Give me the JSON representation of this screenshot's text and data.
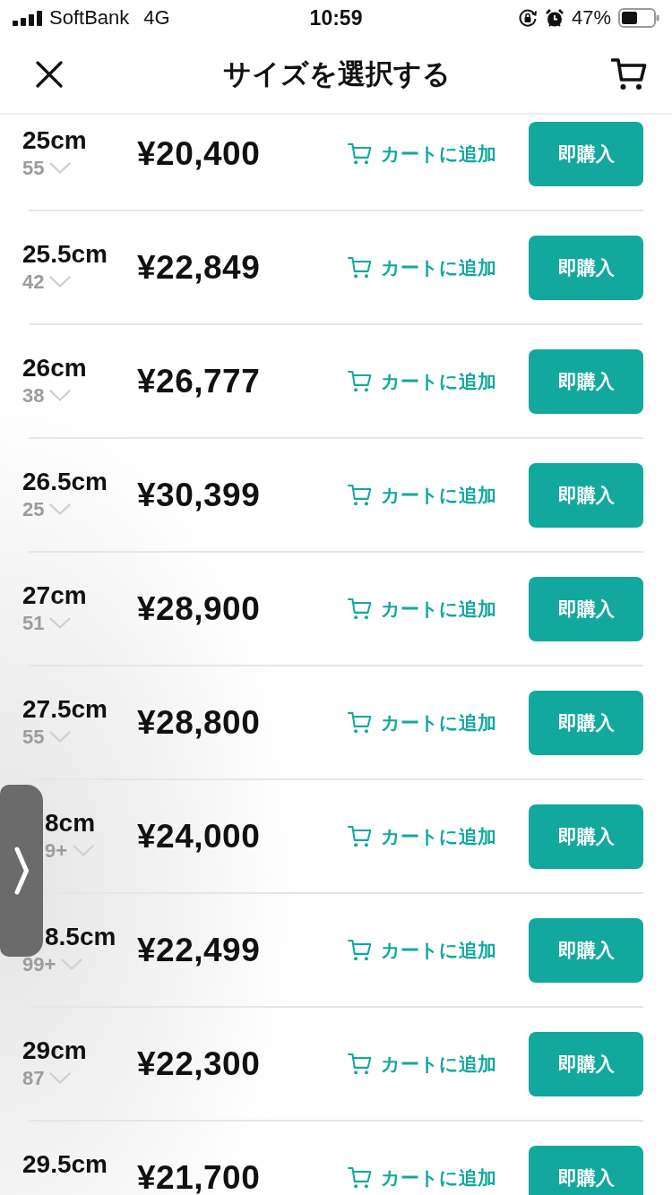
{
  "status_bar": {
    "carrier": "SoftBank",
    "network": "4G",
    "time": "10:59",
    "battery": "47%"
  },
  "header": {
    "title": "サイズを選択する"
  },
  "sizes": [
    {
      "kind": "plain",
      "size": "25cm",
      "stock": "55",
      "price": "¥20,400",
      "cart_label": "カートに追加",
      "buy_label": "即購入"
    },
    {
      "kind": "plain",
      "size": "25.5cm",
      "stock": "42",
      "price": "¥22,849",
      "cart_label": "カートに追加",
      "buy_label": "即購入"
    },
    {
      "kind": "plain",
      "size": "26cm",
      "stock": "38",
      "price": "¥26,777",
      "cart_label": "カートに追加",
      "buy_label": "即購入"
    },
    {
      "kind": "plain",
      "size": "26.5cm",
      "stock": "25",
      "price": "¥30,399",
      "cart_label": "カートに追加",
      "buy_label": "即購入"
    },
    {
      "kind": "plain",
      "size": "27cm",
      "stock": "51",
      "price": "¥28,900",
      "cart_label": "カートに追加",
      "buy_label": "即購入"
    },
    {
      "kind": "plain",
      "size": "27.5cm",
      "stock": "55",
      "price": "¥28,800",
      "cart_label": "カートに追加",
      "buy_label": "即購入"
    },
    {
      "kind": "covered",
      "size": "8cm",
      "stock": "9+",
      "price": "¥24,000",
      "cart_label": "カートに追加",
      "buy_label": "即購入"
    },
    {
      "kind": "clipped",
      "size": "8.5cm",
      "stock": "99+",
      "price": "¥22,499",
      "cart_label": "カートに追加",
      "buy_label": "即購入"
    },
    {
      "kind": "plain",
      "size": "29cm",
      "stock": "87",
      "price": "¥22,300",
      "cart_label": "カートに追加",
      "buy_label": "即購入"
    },
    {
      "kind": "plain",
      "size": "29.5cm",
      "price": "¥21,700",
      "cart_label": "カートに追加",
      "buy_label": "即購入"
    }
  ]
}
